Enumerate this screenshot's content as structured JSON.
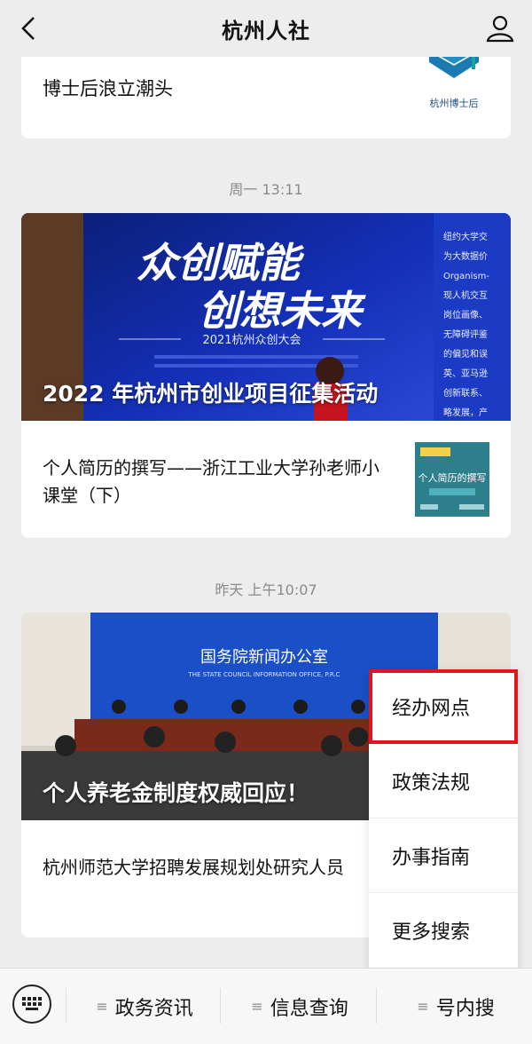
{
  "header": {
    "title": "杭州人社"
  },
  "feed": {
    "card1": {
      "text": "博士后浪立潮头",
      "thumb_label": "杭州博士后"
    },
    "time1": "周一 13:11",
    "card2": {
      "hero_caption": "2022 年杭州市创业项目征集活动",
      "hero_big1": "众创赋能",
      "hero_big2": "创想未来",
      "hero_event": "2021杭州众创大会",
      "sub_text": "个人简历的撰写——浙江工业大学孙老师小课堂（下）",
      "thumb_label": "个人简历的撰写"
    },
    "time2": "昨天 上午10:07",
    "card3": {
      "hero_caption": "个人养老金制度权威回应！",
      "hero_banner": "国务院新闻办公室",
      "hero_banner_en": "THE STATE COUNCIL INFORMATION OFFICE, P.R.C",
      "sub_text": "杭州师范大学招聘发展规划处研究人员"
    }
  },
  "popup_menu": {
    "items": [
      "经办网点",
      "政策法规",
      "办事指南",
      "更多搜索"
    ],
    "highlight_color": "#e2141c"
  },
  "bottom_menu": {
    "items": [
      "政务资讯",
      "信息查询",
      "号内搜"
    ]
  }
}
